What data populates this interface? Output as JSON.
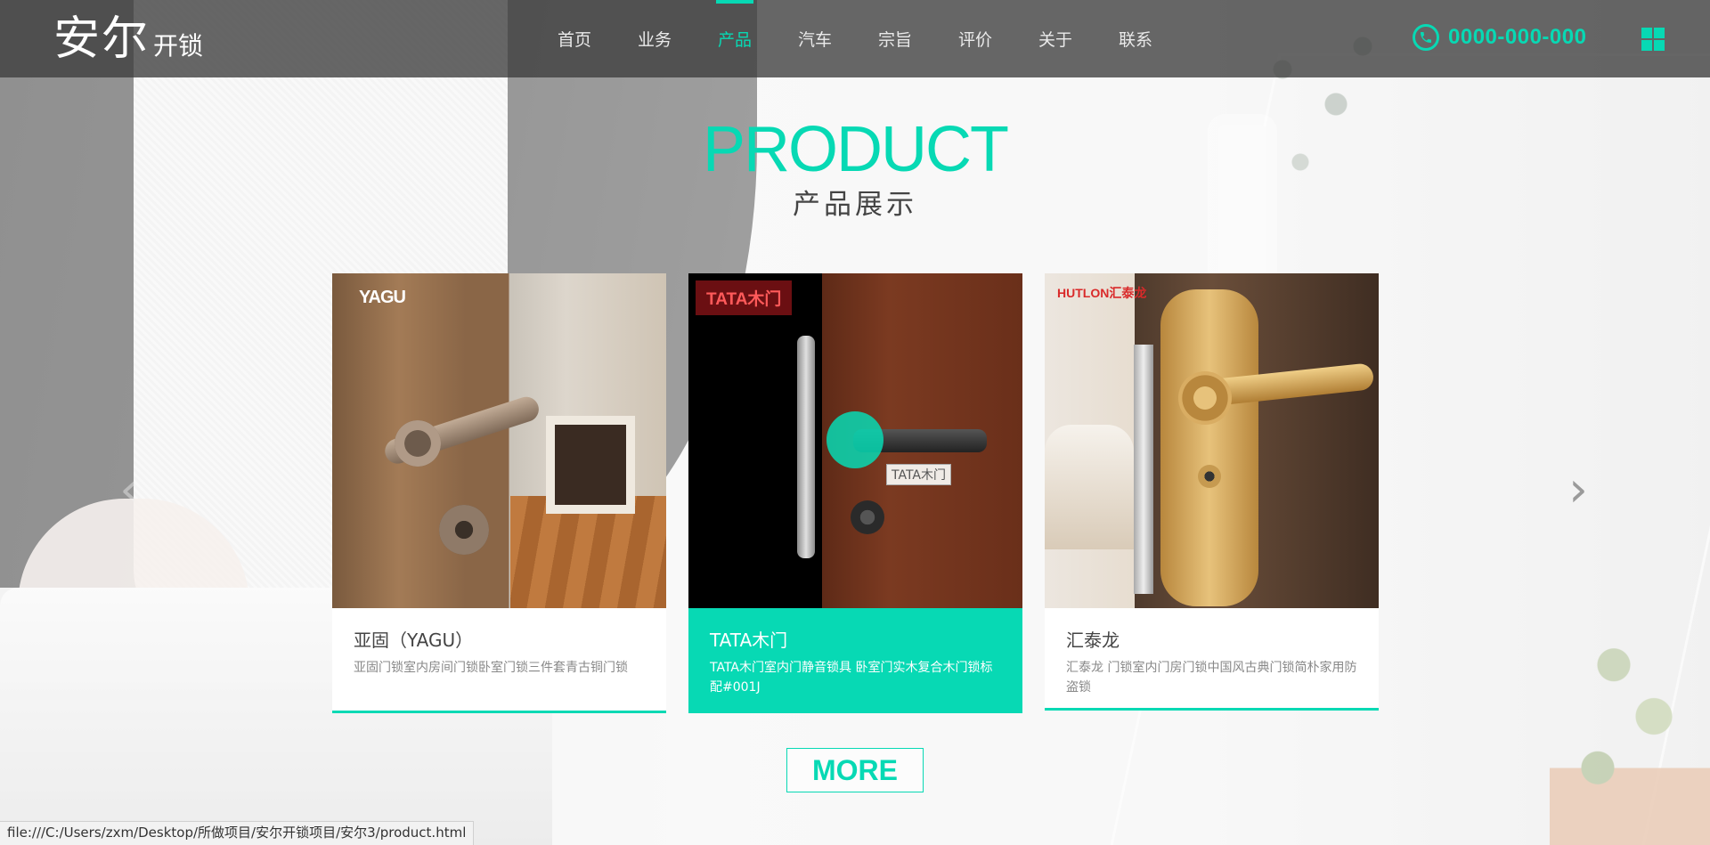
{
  "header": {
    "logo_main": "安尔",
    "logo_sub": "开锁",
    "nav": [
      {
        "label": "首页"
      },
      {
        "label": "业务"
      },
      {
        "label": "产品"
      },
      {
        "label": "汽车"
      },
      {
        "label": "宗旨"
      },
      {
        "label": "评价"
      },
      {
        "label": "关于"
      },
      {
        "label": "联系"
      }
    ],
    "active_nav": "产品",
    "phone": "0000-000-000",
    "phone_icon": "phone-icon",
    "menu_icon": "grid-menu-icon"
  },
  "section": {
    "title": "PRODUCT",
    "subtitle": "产品展示"
  },
  "products": [
    {
      "brand": "YAGU",
      "name": "亚固（YAGU）",
      "desc": "亚固门锁室内房间门锁卧室门锁三件套青古铜门锁"
    },
    {
      "brand": "TATA木门",
      "tag": "TATA木门",
      "name": "TATA木门",
      "desc": "TATA木门室内门静音锁具 卧室门实木复合木门锁标配#001J"
    },
    {
      "brand": "HUTLON汇泰龙",
      "name": "汇泰龙",
      "desc": "汇泰龙 门锁室内门房门锁中国风古典门锁简朴家用防盗锁"
    }
  ],
  "controls": {
    "prev": "‹",
    "next": "›",
    "more": "MORE"
  },
  "status_bar": "file:///C:/Users/zxm/Desktop/所做项目/安尔开锁项目/安尔3/product.html",
  "colors": {
    "accent": "#07d9b4",
    "header_bg": "#3c3c3c"
  }
}
